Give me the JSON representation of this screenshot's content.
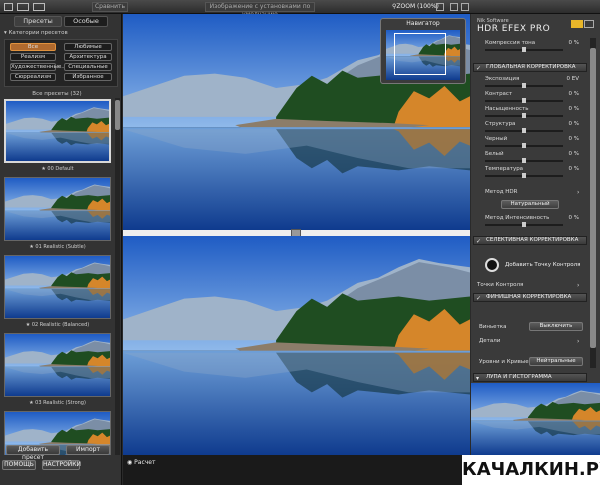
{
  "topbar": {
    "compare_label": "Сравнить",
    "view_label": "Изображение с установками по умолчанию",
    "zoom_label": "ZOOM (100%)"
  },
  "left": {
    "tabs": [
      "Пресеты",
      "Особые"
    ],
    "categories_title": "Категории пресетов",
    "categories": [
      [
        "Все",
        "Любимые"
      ],
      [
        "Реализм",
        "Архитектура"
      ],
      [
        "Художественные...",
        "Специальные"
      ],
      [
        "Сюрреализм",
        "Избранное"
      ]
    ],
    "all_presets_label": "Все пресеты (32)",
    "presets": [
      "00 Default",
      "01 Realistic (Subtle)",
      "02 Realistic (Balanced)",
      "03 Realistic (Strong)",
      ""
    ],
    "add_preset_label": "Добавить пресет",
    "import_label": "Импорт",
    "help_label": "ПОМОЩЬ",
    "settings_label": "НАСТРОЙКИ"
  },
  "center": {
    "navigator_title": "Навигатор",
    "preview_label": "Расчет"
  },
  "right": {
    "brand_small": "Nik Software",
    "brand_title": "HDR EFEX PRO",
    "compression_label": "Компрессия тона",
    "compression_value": "0 %",
    "global_section": "ГЛОБАЛЬНАЯ КОРРЕКТИРОВКА",
    "global_rows": [
      {
        "label": "Экспозиция",
        "value": "0 EV",
        "level": 0.5
      },
      {
        "label": "Контраст",
        "value": "0 %",
        "level": 0.5
      },
      {
        "label": "Насыщенность",
        "value": "0 %",
        "level": 0.5
      },
      {
        "label": "Структура",
        "value": "0 %",
        "level": 0.5
      },
      {
        "label": "Черный",
        "value": "0 %",
        "level": 0.5
      },
      {
        "label": "Белый",
        "value": "0 %",
        "level": 0.5
      },
      {
        "label": "Температура",
        "value": "0 %",
        "level": 0.5
      }
    ],
    "hdr_method_label": "Метод HDR",
    "hdr_method_value": "Натуральный",
    "method_intensity_label": "Метод Интенсивность",
    "method_intensity_value": "0 %",
    "selective_section": "СЕЛЕКТИВНАЯ КОРРЕКТИРОВКА",
    "add_control_point_label": "Добавить Точку Контроля",
    "control_points_label": "Точки Контроля",
    "finish_section": "ФИНИШНАЯ КОРРЕКТИРОВКА",
    "vignette_label": "Виньетка",
    "vignette_value": "Выключить",
    "details_label": "Детали",
    "levels_label": "Уровни и Кривые",
    "levels_value": "Нейтральные",
    "loupe_section": "ЛУПА И ГИСТОГРАММА"
  },
  "watermark": "КАЧАЛКИН.РУ",
  "colors": {
    "accent": "#e0923e",
    "panel": "#333333",
    "sky": "#2d6fcf"
  }
}
